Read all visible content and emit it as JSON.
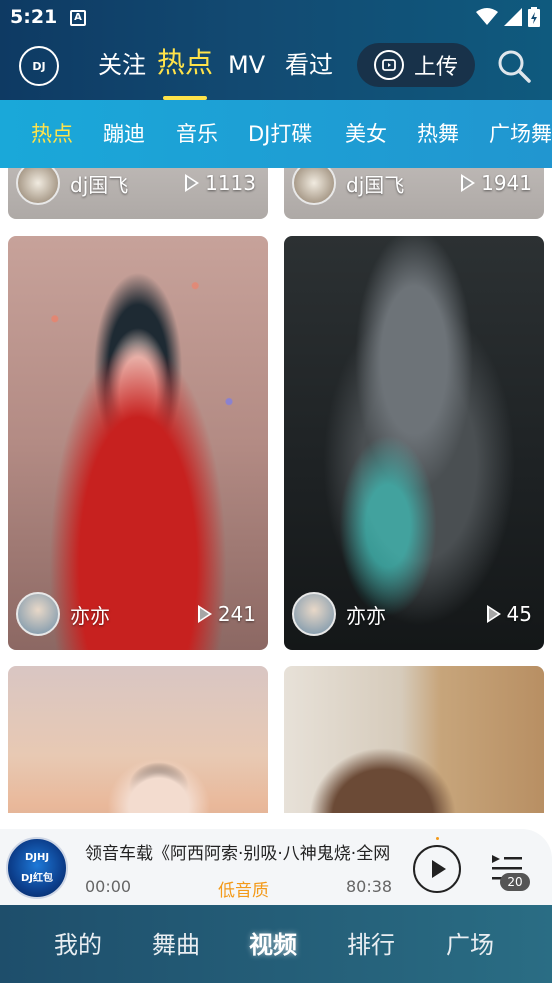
{
  "status_bar": {
    "time": "5:21",
    "notification_icon": "A"
  },
  "header": {
    "logo_text": "DJ",
    "tabs": [
      {
        "label": "关注"
      },
      {
        "label": "热点",
        "active": true
      },
      {
        "label": "MV"
      },
      {
        "label": "看过"
      }
    ],
    "upload_label": "上传"
  },
  "categories": [
    "热点",
    "蹦迪",
    "音乐",
    "DJ打碟",
    "美女",
    "热舞",
    "广场舞"
  ],
  "feed": {
    "cards": [
      {
        "author": "dj国飞",
        "plays": "1113"
      },
      {
        "author": "dj国飞",
        "plays": "1941"
      },
      {
        "author": "亦亦",
        "plays": "241"
      },
      {
        "author": "亦亦",
        "plays": "45"
      },
      {
        "author": "",
        "plays": ""
      },
      {
        "author": "",
        "plays": ""
      }
    ]
  },
  "player": {
    "disc_label_top": "DJHJ",
    "disc_label_bottom": "DJ红包",
    "track_title": "领音车载《阿西阿索·别吸·八神鬼烧·全网",
    "current_time": "00:00",
    "quality": "低音质",
    "duration": "80:38",
    "queue_count": "20"
  },
  "bottom_nav": [
    {
      "label": "我的"
    },
    {
      "label": "舞曲"
    },
    {
      "label": "视频",
      "active": true
    },
    {
      "label": "排行"
    },
    {
      "label": "广场"
    }
  ],
  "colors": {
    "accent_yellow": "#ffe34a",
    "header_bg": "#0e3a63",
    "category_bg": "#1aa8d9",
    "quality_orange": "#f39a1a"
  }
}
